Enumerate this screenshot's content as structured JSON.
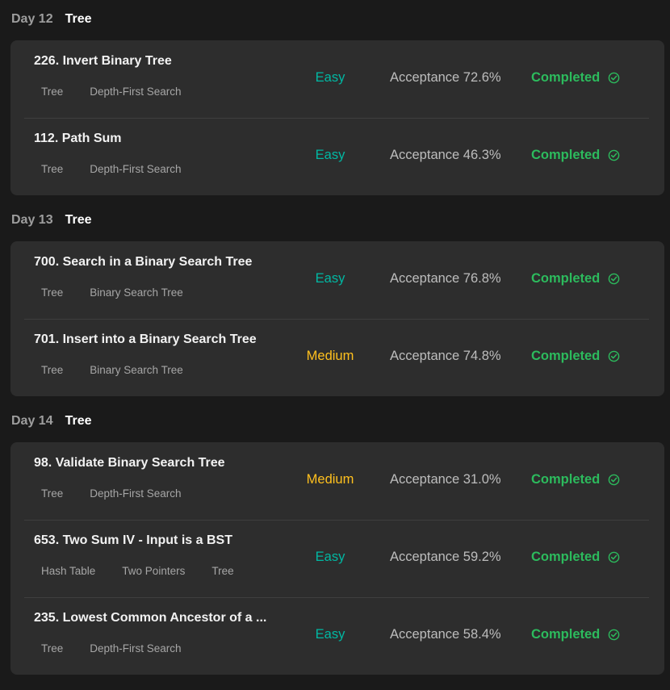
{
  "days": [
    {
      "label": "Day 12",
      "topic": "Tree",
      "problems": [
        {
          "title": "226. Invert Binary Tree",
          "tags": [
            "Tree",
            "Depth-First Search"
          ],
          "difficulty": "Easy",
          "acceptance": "Acceptance 72.6%",
          "status": "Completed"
        },
        {
          "title": "112. Path Sum",
          "tags": [
            "Tree",
            "Depth-First Search"
          ],
          "difficulty": "Easy",
          "acceptance": "Acceptance 46.3%",
          "status": "Completed"
        }
      ]
    },
    {
      "label": "Day 13",
      "topic": "Tree",
      "problems": [
        {
          "title": "700. Search in a Binary Search Tree",
          "tags": [
            "Tree",
            "Binary Search Tree"
          ],
          "difficulty": "Easy",
          "acceptance": "Acceptance 76.8%",
          "status": "Completed"
        },
        {
          "title": "701. Insert into a Binary Search Tree",
          "tags": [
            "Tree",
            "Binary Search Tree"
          ],
          "difficulty": "Medium",
          "acceptance": "Acceptance 74.8%",
          "status": "Completed"
        }
      ]
    },
    {
      "label": "Day 14",
      "topic": "Tree",
      "problems": [
        {
          "title": "98. Validate Binary Search Tree",
          "tags": [
            "Tree",
            "Depth-First Search"
          ],
          "difficulty": "Medium",
          "acceptance": "Acceptance 31.0%",
          "status": "Completed"
        },
        {
          "title": "653. Two Sum IV - Input is a BST",
          "tags": [
            "Hash Table",
            "Two Pointers",
            "Tree"
          ],
          "difficulty": "Easy",
          "acceptance": "Acceptance 59.2%",
          "status": "Completed"
        },
        {
          "title": "235. Lowest Common Ancestor of a ...",
          "tags": [
            "Tree",
            "Depth-First Search"
          ],
          "difficulty": "Easy",
          "acceptance": "Acceptance 58.4%",
          "status": "Completed"
        }
      ]
    }
  ],
  "icons": {
    "status": "check-circle-icon"
  },
  "colors": {
    "background": "#1a1a1a",
    "card": "#2d2d2d",
    "easy": "#00b8a3",
    "medium": "#ffc01e",
    "completed": "#2cbb5d"
  }
}
